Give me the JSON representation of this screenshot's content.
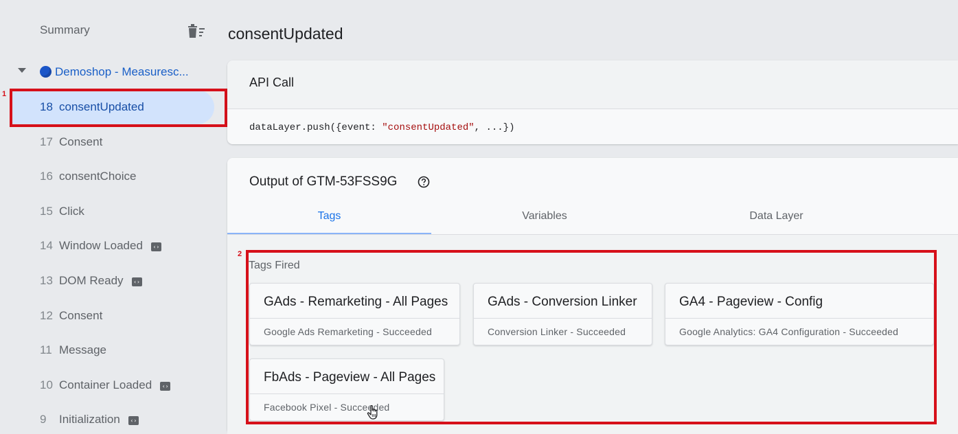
{
  "sidebar": {
    "summary_label": "Summary",
    "container_label": "Demoshop - Measuresc...",
    "events": [
      {
        "num": "18",
        "name": "consentUpdated",
        "selected": true,
        "badge": false
      },
      {
        "num": "17",
        "name": "Consent",
        "selected": false,
        "badge": false
      },
      {
        "num": "16",
        "name": "consentChoice",
        "selected": false,
        "badge": false
      },
      {
        "num": "15",
        "name": "Click",
        "selected": false,
        "badge": false
      },
      {
        "num": "14",
        "name": "Window Loaded",
        "selected": false,
        "badge": true
      },
      {
        "num": "13",
        "name": "DOM Ready",
        "selected": false,
        "badge": true
      },
      {
        "num": "12",
        "name": "Consent",
        "selected": false,
        "badge": false
      },
      {
        "num": "11",
        "name": "Message",
        "selected": false,
        "badge": false
      },
      {
        "num": "10",
        "name": "Container Loaded",
        "selected": false,
        "badge": true
      },
      {
        "num": "9",
        "name": "Initialization",
        "selected": false,
        "badge": true
      }
    ]
  },
  "annotations": {
    "first": "1",
    "second": "2"
  },
  "main": {
    "title": "consentUpdated",
    "api_call": {
      "title": "API Call",
      "code_prefix": "dataLayer.push({event: ",
      "code_string": "\"consentUpdated\"",
      "code_suffix": ", ...})"
    },
    "output": {
      "title": "Output of GTM-53FSS9G",
      "tabs": [
        "Tags",
        "Variables",
        "Data Layer"
      ],
      "active_tab": "Tags",
      "section_title": "Tags Fired",
      "tags": [
        {
          "title": "GAds - Remarketing - All Pages",
          "subtitle": "Google Ads Remarketing - Succeeded"
        },
        {
          "title": "GAds - Conversion Linker",
          "subtitle": "Conversion Linker - Succeeded"
        },
        {
          "title": "GA4 - Pageview - Config",
          "subtitle": "Google Analytics: GA4 Configuration - Succeeded"
        },
        {
          "title": "FbAds - Pageview - All Pages",
          "subtitle": "Facebook Pixel - Succeeded"
        }
      ]
    }
  },
  "colors": {
    "accent": "#1a73e8",
    "annotation_red": "#d6101a",
    "selected_bg": "#d2e3fc"
  },
  "icons": [
    "delete-sweep-icon",
    "caret-down-icon",
    "container-dot-icon",
    "gtm-tag-icon",
    "help-icon",
    "hand-cursor-icon"
  ]
}
